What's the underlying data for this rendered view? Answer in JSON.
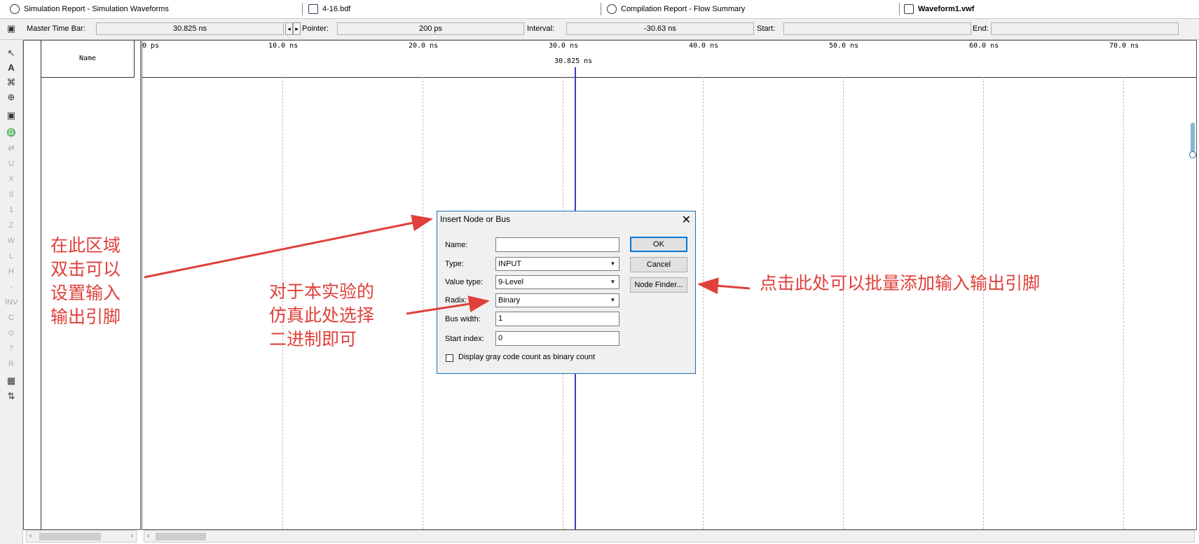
{
  "tabs": [
    {
      "label": "Simulation Report - Simulation Waveforms"
    },
    {
      "label": "4-16.bdf"
    },
    {
      "label": "Compilation Report - Flow Summary"
    },
    {
      "label": "Waveform1.vwf"
    }
  ],
  "timebar": {
    "master_label": "Master Time Bar:",
    "master_value": "30.825 ns",
    "pointer_label": "Pointer:",
    "pointer_value": "200 ps",
    "interval_label": "Interval:",
    "interval_value": "-30.63 ns",
    "start_label": "Start:",
    "start_value": "",
    "end_label": "End:",
    "end_value": ""
  },
  "name_header": "Name",
  "ruler": {
    "ticks": [
      "0 ps",
      "10.0 ns",
      "20.0 ns",
      "30.0 ns",
      "40.0 ns",
      "50.0 ns",
      "60.0 ns",
      "70.0 ns"
    ],
    "cursor_label": "30.825 ns"
  },
  "dialog": {
    "title": "Insert Node or Bus",
    "name_label": "Name:",
    "name_value": "",
    "type_label": "Type:",
    "type_value": "INPUT",
    "value_type_label": "Value type:",
    "value_type_value": "9-Level",
    "radix_label": "Radix:",
    "radix_value": "Binary",
    "bus_width_label": "Bus width:",
    "bus_width_value": "1",
    "start_index_label": "Start index:",
    "start_index_value": "0",
    "ok_label": "OK",
    "cancel_label": "Cancel",
    "node_finder_label": "Node Finder...",
    "gray_code_label": "Display gray code count as binary count"
  },
  "annotations": {
    "left": "在此区域\n双击可以\n设置输入\n输出引脚",
    "middle": "对于本实验的\n仿真此处选择\n二进制即可",
    "right": "点击此处可以批量添加输入输出引脚"
  },
  "colors": {
    "annotation": "#e0403a",
    "cursor": "#3b3bc8",
    "dialog_border": "#1f6fb8"
  }
}
